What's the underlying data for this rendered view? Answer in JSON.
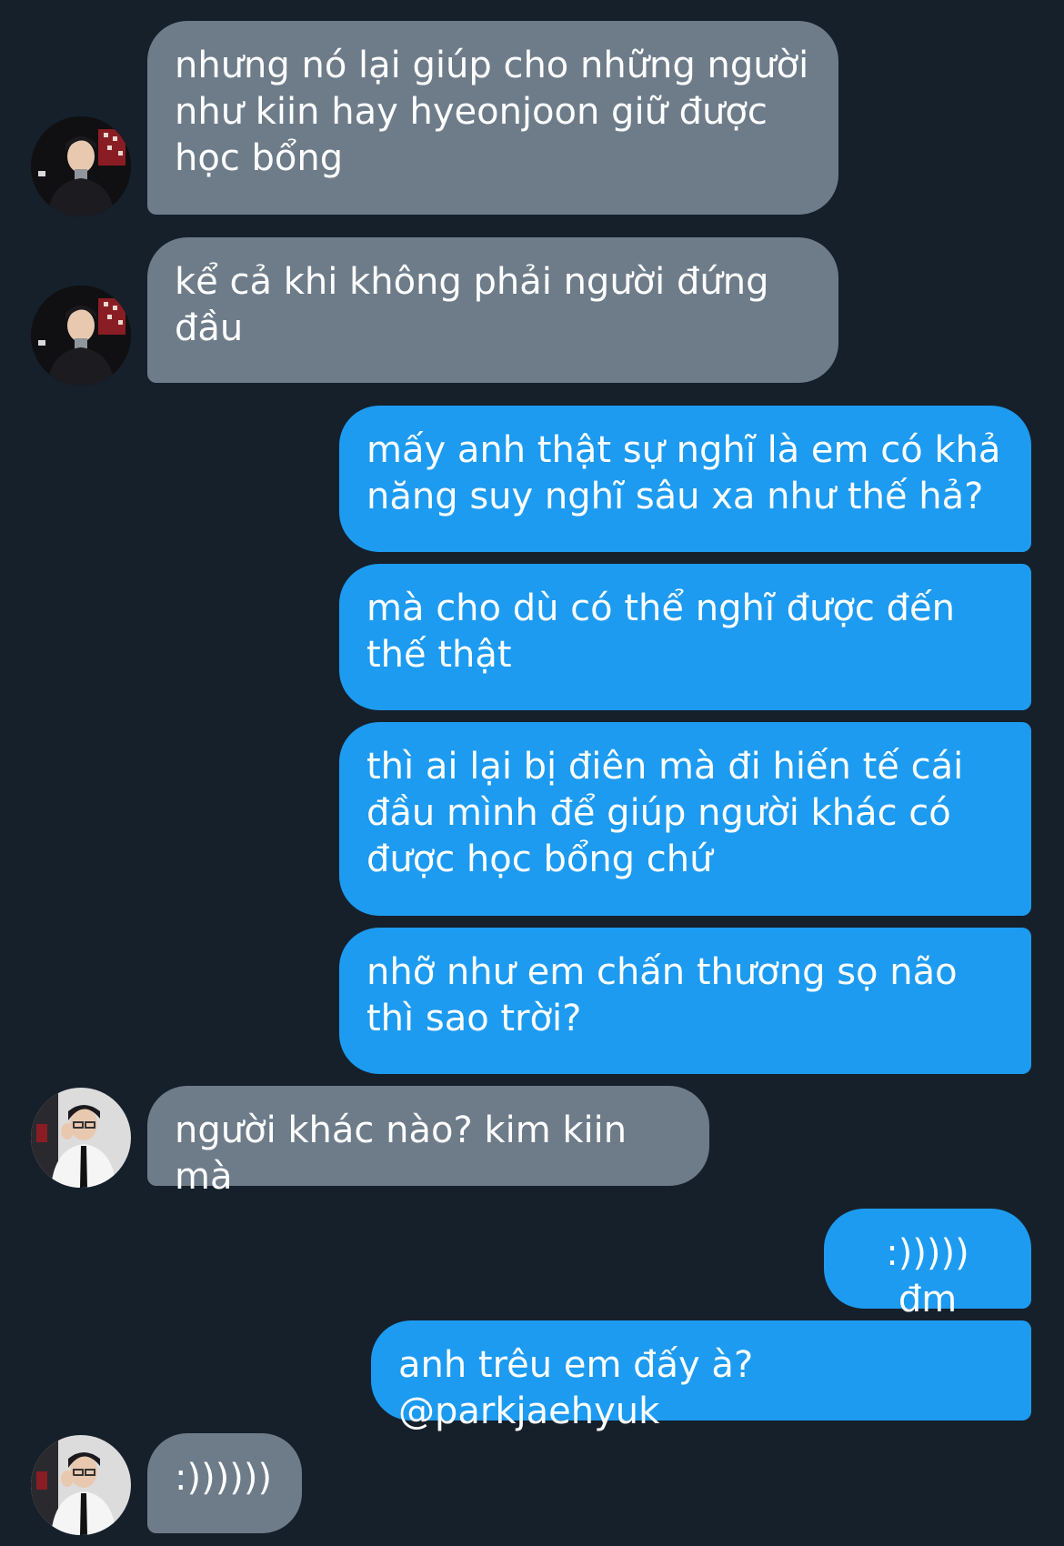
{
  "conversation": {
    "messages": [
      {
        "side": "in",
        "avatar": "dark-avatar",
        "text": "nhưng nó lại giúp cho những người như kiin hay hyeonjoon giữ được học bổng"
      },
      {
        "side": "in",
        "avatar": "dark-avatar",
        "text": "kể cả khi không phải người đứng đầu"
      },
      {
        "side": "out",
        "text": "mấy anh thật sự nghĩ là em có khả năng suy nghĩ sâu xa như thế hả?"
      },
      {
        "side": "out",
        "text": "mà cho dù có thể nghĩ được đến thế thật"
      },
      {
        "side": "out",
        "text": "thì ai lại bị điên mà đi hiến tế cái đầu mình để giúp người khác có được học bổng chứ"
      },
      {
        "side": "out",
        "text": "nhỡ như em chấn thương sọ não thì sao trời?"
      },
      {
        "side": "in",
        "avatar": "light-avatar",
        "text": "người khác nào? kim kiin mà"
      },
      {
        "side": "out",
        "text": ":))))) đm"
      },
      {
        "side": "out",
        "text": "anh trêu em đấy à? @parkjaehyuk"
      },
      {
        "side": "in",
        "avatar": "light-avatar",
        "text": ":))))))"
      }
    ]
  },
  "colors": {
    "background": "#15202b",
    "incoming_bubble": "#6e7c8a",
    "outgoing_bubble": "#1d9bf0",
    "text": "#ffffff"
  }
}
